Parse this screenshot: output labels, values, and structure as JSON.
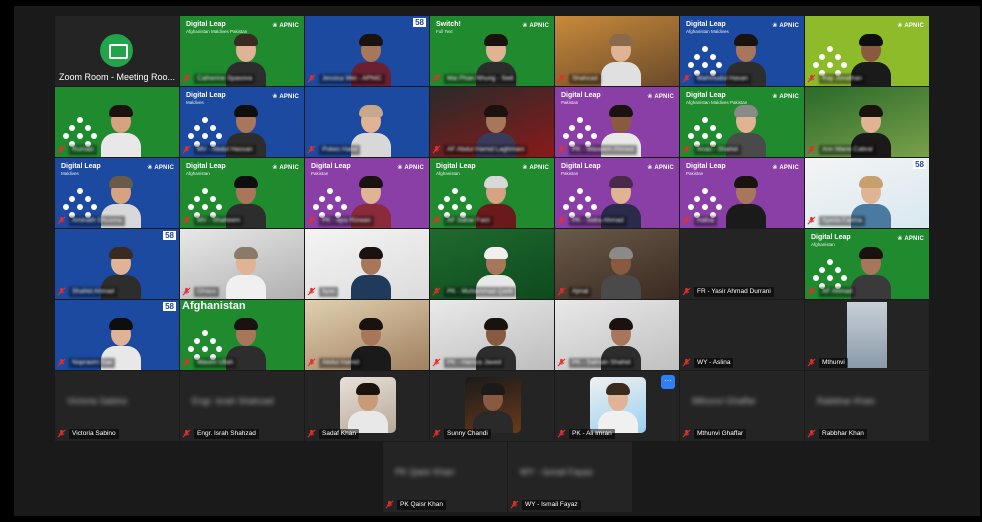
{
  "meeting": {
    "zoom_room_label": "Zoom Room - Meeting Roo...",
    "more_button": "···"
  },
  "colors": {
    "green": "#1f8a2e",
    "blue": "#1c4aa0",
    "purple": "#8a3fa6",
    "active_outline": "#3ec45c",
    "mute_red": "#e0302e"
  },
  "brand": {
    "digital_leap": "Digital Leap",
    "apnic": "APNIC",
    "apnic58": "58",
    "switch": "Switch!",
    "afghanistan_banner": "Afghanistan"
  },
  "tiles_visible_names": {
    "r4c6": "FR - Yasir Ahmad Durrani",
    "r5c6": "WY - Aslina",
    "r5c7": "Mthunvi",
    "r6c1": "Victoria Sabino",
    "r6c2": "Engr. Israh Shahzad",
    "r6c3": "Sadaf Khan",
    "r6c4": "Sunny Chandi",
    "r6c5": "PK - Ali Imran",
    "r6c6": "Mthunvi Ghaffar",
    "r6c7": "Rabbhar Khan",
    "r7c1": "PK Qaisr Khan",
    "r7c2": "WY - Ismail Fayaz"
  }
}
